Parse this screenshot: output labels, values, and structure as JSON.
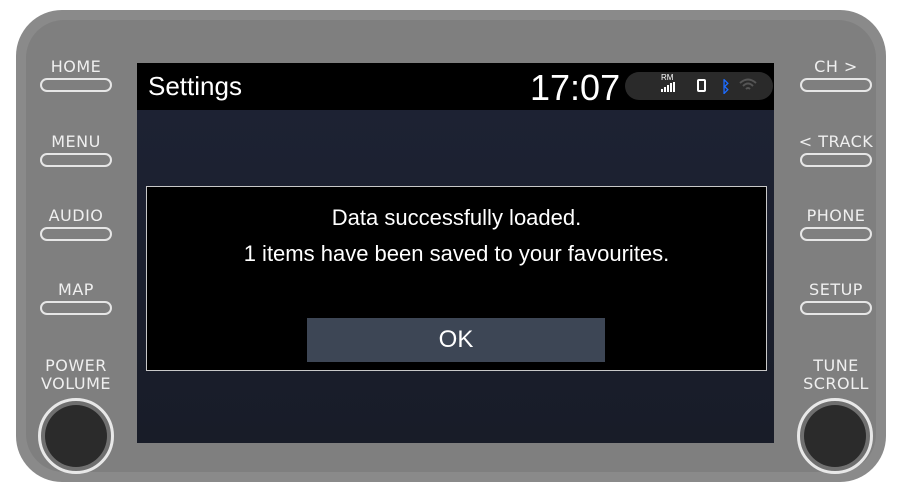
{
  "left_buttons": [
    {
      "label": "HOME"
    },
    {
      "label": "MENU"
    },
    {
      "label": "AUDIO"
    },
    {
      "label": "MAP"
    }
  ],
  "right_buttons": [
    {
      "label": "CH >"
    },
    {
      "label": "< TRACK"
    },
    {
      "label": "PHONE"
    },
    {
      "label": "SETUP"
    }
  ],
  "left_knob": {
    "line1": "POWER",
    "line2": "VOLUME"
  },
  "right_knob": {
    "line1": "TUNE",
    "line2": "SCROLL"
  },
  "screen": {
    "title": "Settings",
    "clock": "17:07",
    "status": {
      "rm_label": "RM",
      "bluetooth_color": "#1d6cff"
    }
  },
  "dialog": {
    "line1": "Data successfully loaded.",
    "line2": "1 items have been saved to your favourites.",
    "ok_label": "OK"
  }
}
